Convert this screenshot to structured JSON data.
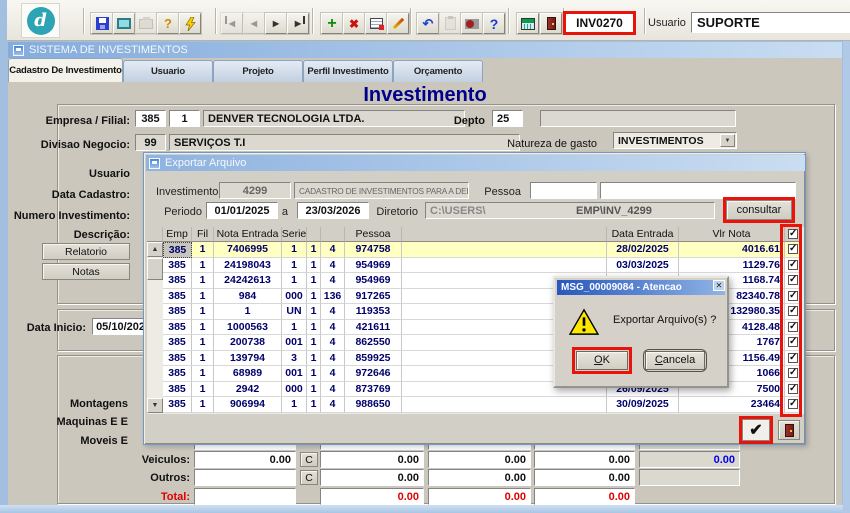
{
  "toolbar": {
    "buttons": [
      {
        "icon": "save-icon",
        "disabled": false
      },
      {
        "icon": "screen-icon",
        "disabled": false
      },
      {
        "icon": "print-icon",
        "disabled": true
      },
      {
        "icon": "search-help-icon",
        "disabled": false
      },
      {
        "icon": "lightning-icon",
        "disabled": false
      },
      {
        "icon": "first-record-icon",
        "disabled": true
      },
      {
        "icon": "prev-record-icon",
        "disabled": true
      },
      {
        "icon": "next-record-icon",
        "disabled": false
      },
      {
        "icon": "last-record-icon",
        "disabled": false
      },
      {
        "icon": "add-record-icon",
        "disabled": false
      },
      {
        "icon": "delete-record-icon",
        "disabled": false
      },
      {
        "icon": "edit-grid-icon",
        "disabled": false
      },
      {
        "icon": "clear-icon",
        "disabled": false
      },
      {
        "icon": "undo-icon",
        "disabled": false
      },
      {
        "icon": "paste-icon",
        "disabled": true
      },
      {
        "icon": "media-icon",
        "disabled": false
      },
      {
        "icon": "help-icon",
        "disabled": false
      },
      {
        "icon": "calc-icon",
        "disabled": false
      },
      {
        "icon": "exit-icon",
        "disabled": false
      }
    ],
    "code_badge": "INV0270",
    "user_label": "Usuario",
    "user_value": "SUPORTE"
  },
  "window": {
    "title": "SISTEMA DE INVESTIMENTOS"
  },
  "tabs": [
    {
      "label": "Cadastro De Investimento",
      "active": true
    },
    {
      "label": "Usuario",
      "active": false
    },
    {
      "label": "Projeto",
      "active": false
    },
    {
      "label": "Perfil Investimento",
      "active": false
    },
    {
      "label": "Orçamento",
      "active": false
    }
  ],
  "page_title": "Investimento",
  "form": {
    "empresa_label": "Empresa / Filial:",
    "empresa": "385",
    "filial": "1",
    "empresa_nome": "DENVER TECNOLOGIA LTDA.",
    "depto_label": "Depto",
    "depto": "25",
    "divisao_label": "Divisao Negocio:",
    "divisao_cod": "99",
    "divisao_nome": "SERVIÇOS T.I",
    "natureza_label": "Natureza de gasto",
    "natureza_value": "INVESTIMENTOS",
    "usuario_label": "Usuario",
    "data_cadastro_label": "Data Cadastro:",
    "numero_label": "Numero Investimento:",
    "descricao_label": "Descrição:",
    "relatorio_button": "Relatorio",
    "notas_button": "Notas",
    "data_inicio_label": "Data Inicio:",
    "data_inicio": "05/10/202",
    "montagens_label": "Montagens",
    "maquinas_label": "Maquinas E E",
    "moveis_label": "Moveis E"
  },
  "modal": {
    "title": "Exportar Arquivo",
    "investimento_label": "Investimento",
    "investimento": "4299",
    "descricao": "CADASTRO DE INVESTIMENTOS PARA A DEI",
    "pessoa_label": "Pessoa",
    "periodo_label": "Periodo",
    "periodo_de": "01/01/2025",
    "a_label": "a",
    "periodo_ate": "23/03/2026",
    "diretorio_label": "Diretorio",
    "diretorio_prefix": "C:\\USERS\\",
    "diretorio_suffix": "EMP\\INV_4299",
    "consultar_label": "consultar",
    "grid": {
      "headers": [
        "Emp",
        "Fil",
        "Nota Entrada",
        "Serie",
        "",
        "",
        "Pessoa",
        "",
        "Data Entrada",
        "Vlr Nota"
      ],
      "rows": [
        {
          "emp": "385",
          "fil": "1",
          "nota": "7406995",
          "serie": "1",
          "c5": "1",
          "c6": "4",
          "pessoa": "974758",
          "nome": "",
          "data": "28/02/2025",
          "valor": "4016.61",
          "checked": true,
          "selected": true
        },
        {
          "emp": "385",
          "fil": "1",
          "nota": "24198043",
          "serie": "1",
          "c5": "1",
          "c6": "4",
          "pessoa": "954969",
          "nome": "",
          "data": "03/03/2025",
          "valor": "1129.76",
          "checked": true,
          "selected": false
        },
        {
          "emp": "385",
          "fil": "1",
          "nota": "24242613",
          "serie": "1",
          "c5": "1",
          "c6": "4",
          "pessoa": "954969",
          "nome": "",
          "data": "",
          "valor": "1168.74",
          "checked": true,
          "selected": false
        },
        {
          "emp": "385",
          "fil": "1",
          "nota": "984",
          "serie": "000",
          "c5": "1",
          "c6": "136",
          "pessoa": "917265",
          "nome": "",
          "data": "",
          "valor": "82340.78",
          "checked": true,
          "selected": false
        },
        {
          "emp": "385",
          "fil": "1",
          "nota": "1",
          "serie": "UN",
          "c5": "1",
          "c6": "4",
          "pessoa": "119353",
          "nome": "",
          "data": "",
          "valor": "132980.35",
          "checked": true,
          "selected": false
        },
        {
          "emp": "385",
          "fil": "1",
          "nota": "1000563",
          "serie": "1",
          "c5": "1",
          "c6": "4",
          "pessoa": "421611",
          "nome": "",
          "data": "",
          "valor": "4128.48",
          "checked": true,
          "selected": false
        },
        {
          "emp": "385",
          "fil": "1",
          "nota": "200738",
          "serie": "001",
          "c5": "1",
          "c6": "4",
          "pessoa": "862550",
          "nome": "",
          "data": "",
          "valor": "1767",
          "checked": true,
          "selected": false
        },
        {
          "emp": "385",
          "fil": "1",
          "nota": "139794",
          "serie": "3",
          "c5": "1",
          "c6": "4",
          "pessoa": "859925",
          "nome": "",
          "data": "",
          "valor": "1156.49",
          "checked": true,
          "selected": false
        },
        {
          "emp": "385",
          "fil": "1",
          "nota": "68989",
          "serie": "001",
          "c5": "1",
          "c6": "4",
          "pessoa": "972646",
          "nome": "",
          "data": "",
          "valor": "1066",
          "checked": true,
          "selected": false
        },
        {
          "emp": "385",
          "fil": "1",
          "nota": "2942",
          "serie": "000",
          "c5": "1",
          "c6": "4",
          "pessoa": "873769",
          "nome": "",
          "data": "26/09/2025",
          "valor": "7500",
          "checked": true,
          "selected": false
        },
        {
          "emp": "385",
          "fil": "1",
          "nota": "906994",
          "serie": "1",
          "c5": "1",
          "c6": "4",
          "pessoa": "988650",
          "nome": "",
          "data": "30/09/2025",
          "valor": "23464",
          "checked": true,
          "selected": false
        }
      ]
    }
  },
  "dialog": {
    "title": "MSG_00009084 - Atencao",
    "message": "Exportar Arquivo(s) ?",
    "ok_label": "OK",
    "cancel_label": "Cancela"
  },
  "totals": {
    "rows": [
      {
        "label": "",
        "c_label": "",
        "values": [
          "",
          "",
          "",
          ""
        ],
        "right_value": ""
      },
      {
        "label": "Veiculos:",
        "c_label": "C",
        "values": [
          "0.00",
          "0.00",
          "0.00",
          "0.00"
        ],
        "right_value": "0.00"
      },
      {
        "label": "Outros:",
        "c_label": "C",
        "values": [
          "",
          "0.00",
          "0.00",
          "0.00"
        ],
        "right_value": ""
      },
      {
        "label": "Total:",
        "c_label": "",
        "values": [
          "",
          "0.00",
          "0.00",
          "0.00"
        ],
        "right_value": null
      }
    ]
  }
}
